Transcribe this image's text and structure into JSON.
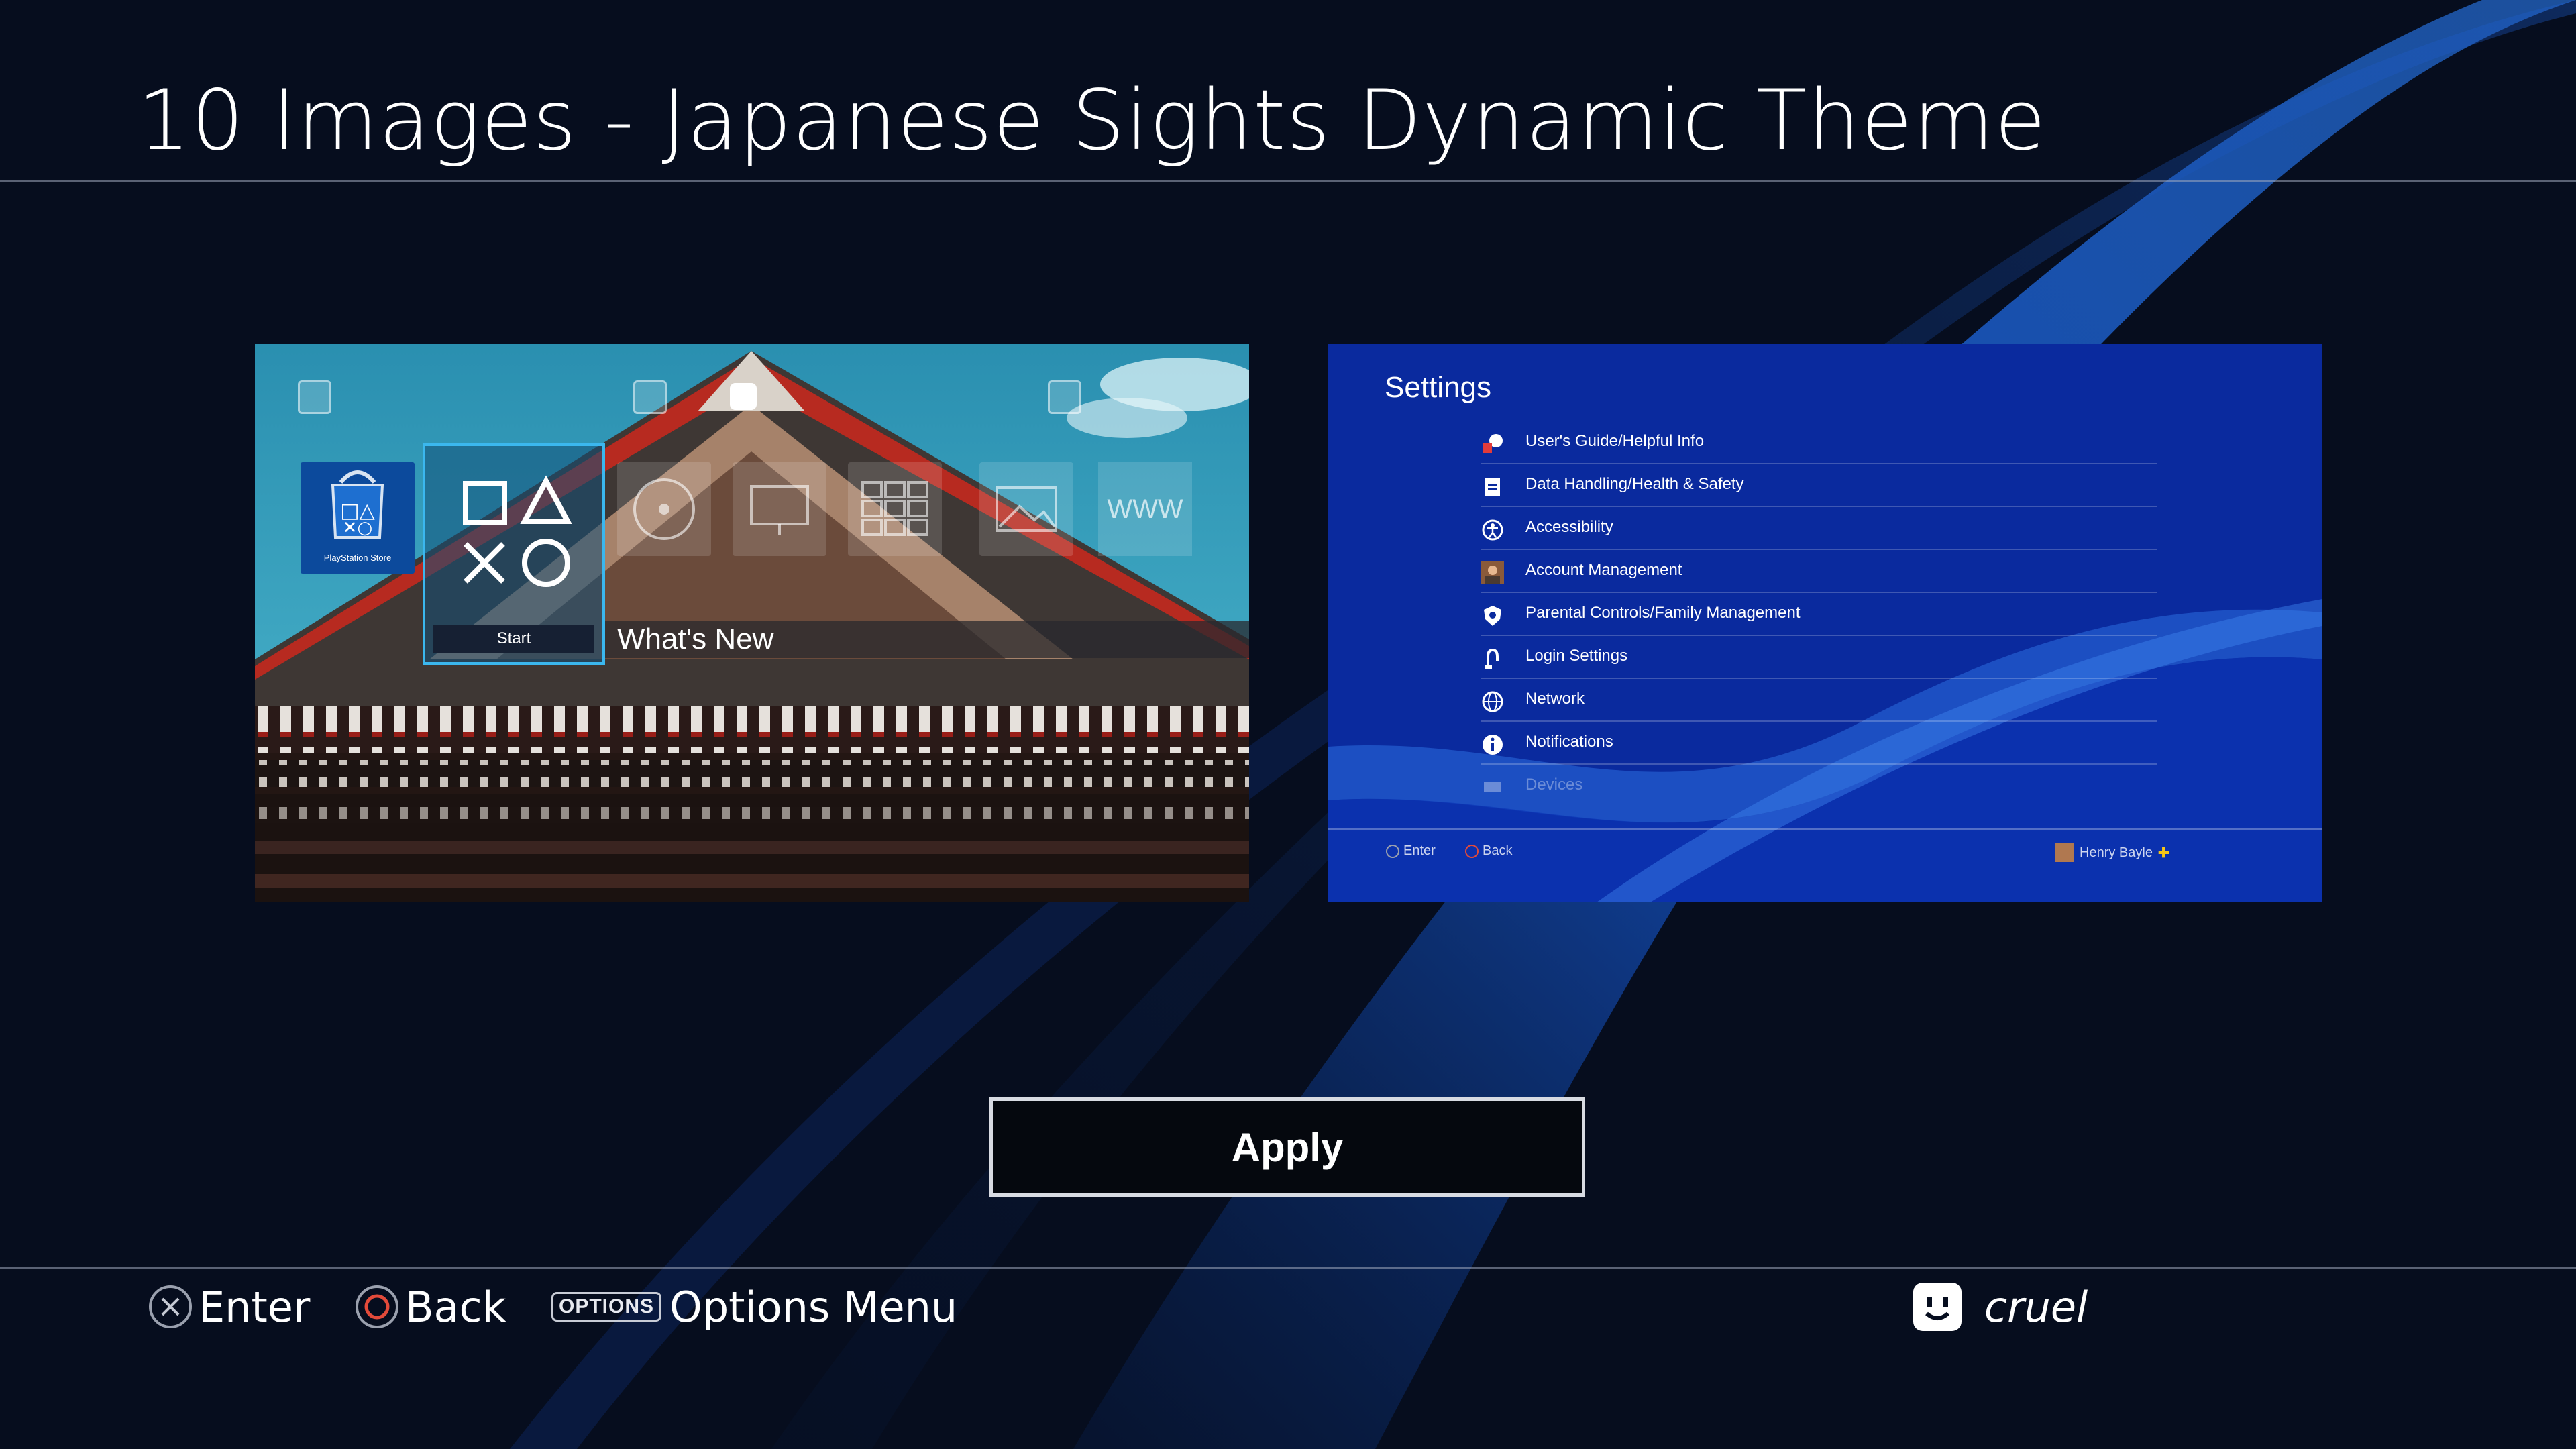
{
  "page": {
    "title": "10 Images - Japanese Sights Dynamic Theme"
  },
  "preview_home": {
    "store_caption": "PlayStation Store",
    "start_label": "Start",
    "whats_new": "What's New",
    "www_label": "WWW"
  },
  "preview_settings": {
    "title": "Settings",
    "items": [
      {
        "label": "User's Guide/Helpful Info",
        "icon": "help-icon"
      },
      {
        "label": "Data Handling/Health & Safety",
        "icon": "data-icon"
      },
      {
        "label": "Accessibility",
        "icon": "accessibility-icon"
      },
      {
        "label": "Account Management",
        "icon": "avatar-icon"
      },
      {
        "label": "Parental Controls/Family Management",
        "icon": "parental-icon"
      },
      {
        "label": "Login Settings",
        "icon": "login-icon"
      },
      {
        "label": "Network",
        "icon": "globe-icon"
      },
      {
        "label": "Notifications",
        "icon": "info-icon"
      },
      {
        "label": "Devices",
        "icon": "devices-icon"
      }
    ],
    "footer_enter": "Enter",
    "footer_back": "Back",
    "footer_user": "Henry Bayle"
  },
  "apply_button": {
    "label": "Apply"
  },
  "bottom_bar": {
    "enter_label": "Enter",
    "back_label": "Back",
    "options_badge": "OPTIONS",
    "options_label": "Options Menu",
    "user_name": "cruel"
  },
  "colors": {
    "background": "#060d1e",
    "wave_blue": "#1d63d6",
    "selection_border": "#3bb7ee",
    "settings_blue": "#0a2a9e"
  }
}
